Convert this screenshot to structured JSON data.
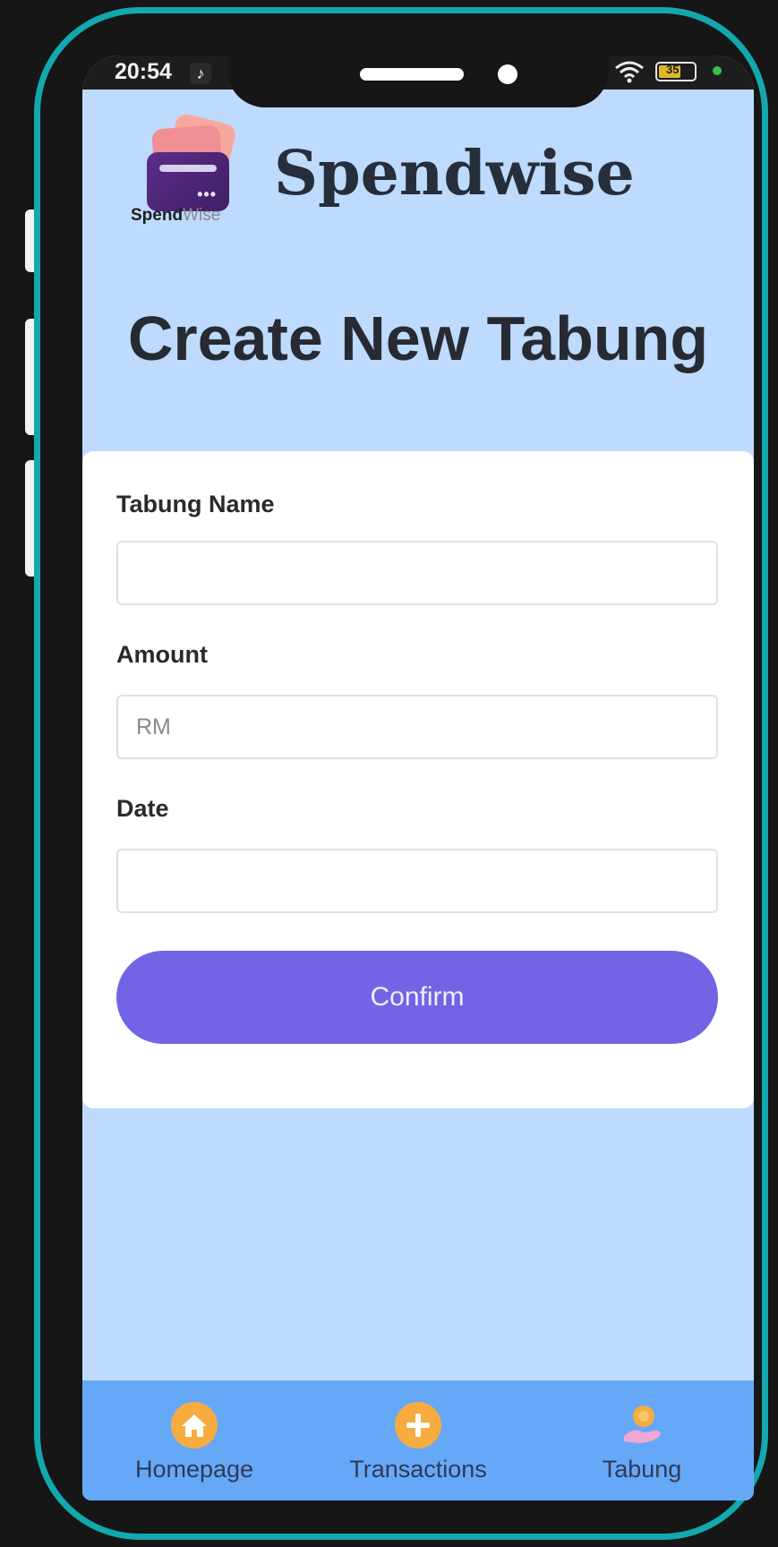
{
  "status_bar": {
    "time": "20:54",
    "battery": "35"
  },
  "app": {
    "brand_title": "Spendwise",
    "logo_text_bold": "Spend",
    "logo_text_light": "Wise"
  },
  "page": {
    "title": "Create New Tabung"
  },
  "form": {
    "tabung_name_label": "Tabung Name",
    "tabung_name_value": "",
    "amount_label": "Amount",
    "amount_placeholder": "RM",
    "date_label": "Date",
    "date_value": "",
    "confirm_label": "Confirm"
  },
  "bottom_nav": {
    "items": [
      {
        "label": "Homepage",
        "icon": "home-icon"
      },
      {
        "label": "Transactions",
        "icon": "plus-circle-icon"
      },
      {
        "label": "Tabung",
        "icon": "coin-hand-icon"
      }
    ]
  },
  "colors": {
    "screen_bg": "#bedafc",
    "accent": "#7364e5",
    "nav_bg": "#66a8f8",
    "frame": "#12a8ad",
    "nav_icon_orange": "#f6ac3f"
  }
}
